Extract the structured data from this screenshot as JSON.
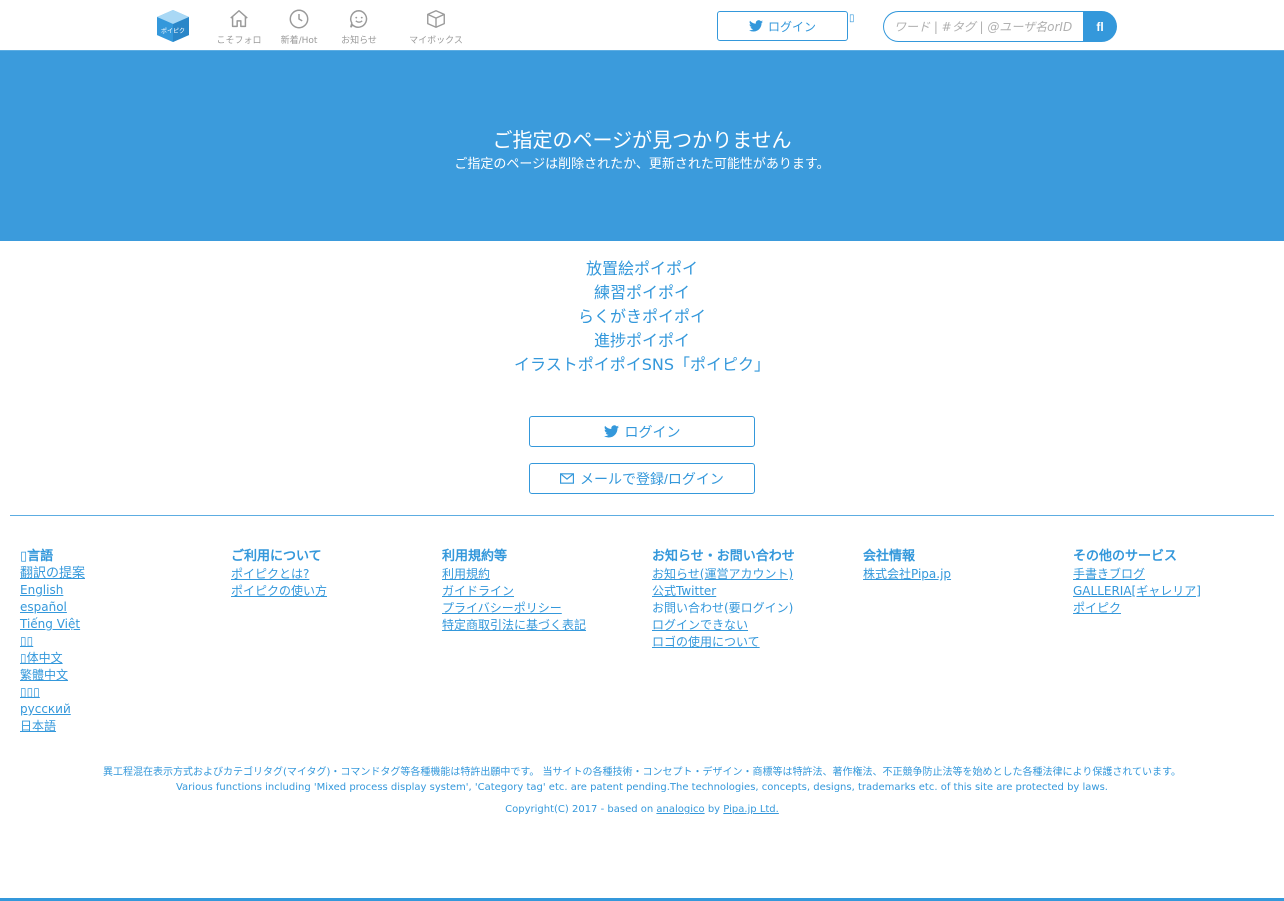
{
  "header": {
    "logo_text": "ポイピク",
    "nav": [
      {
        "label": "こそフォロ",
        "icon": "home-icon"
      },
      {
        "label": "新着/Hot",
        "icon": "clock-icon"
      },
      {
        "label": "お知らせ",
        "icon": "chat-icon"
      },
      {
        "label": "マイボックス",
        "icon": "box-icon"
      }
    ],
    "login_label": "ログイン",
    "tiny_glyph": "▯",
    "search_placeholder": "ワード | #タグ | @ユーザ名orID",
    "search_button": "fl"
  },
  "hero": {
    "title": "ご指定のページが見つかりません",
    "subtitle": "ご指定のページは削除されたか、更新された可能性があります。"
  },
  "links": [
    "放置絵ポイポイ",
    "練習ポイポイ",
    "らくがきポイポイ",
    "進捗ポイポイ",
    "イラストポイポイSNS「ポイピク」"
  ],
  "actions": {
    "twitter_login": "ログイン",
    "mail_login": "メールで登録/ログイン"
  },
  "footer": {
    "language": {
      "heading_glyph": "▯",
      "heading": "言語",
      "suggest": "翻訳の提案",
      "items": [
        "English",
        "español",
        "Tiếng Việt",
        "▯▯",
        "▯体中文",
        "繁體中文",
        "▯▯▯",
        "русский",
        "日本語"
      ]
    },
    "about": {
      "heading": "ご利用について",
      "items": [
        "ポイピクとは?",
        "ポイピクの使い方"
      ]
    },
    "terms": {
      "heading": "利用規約等",
      "items": [
        "利用規約",
        "ガイドライン",
        "プライバシーポリシー",
        "特定商取引法に基づく表記"
      ]
    },
    "contact": {
      "heading": "お知らせ・お問い合わせ",
      "items": [
        "お知らせ(運営アカウント)",
        "公式Twitter"
      ],
      "plain_item": "お問い合わせ(要ログイン)",
      "items2": [
        "ログインできない",
        "ロゴの使用について"
      ]
    },
    "company": {
      "heading": "会社情報",
      "items": [
        "株式会社Pipa.jp"
      ]
    },
    "services": {
      "heading": "その他のサービス",
      "items": [
        "手書きブログ",
        "GALLERIA[ギャレリア]",
        "ポイピク"
      ]
    },
    "notice_jp": "異工程混在表示方式およびカテゴリタグ(マイタグ)・コマンドタグ等各種機能は特許出願中です。 当サイトの各種技術・コンセプト・デザイン・商標等は特許法、著作権法、不正競争防止法等を始めとした各種法律により保護されています。",
    "notice_en": "Various functions including 'Mixed process display system', 'Category tag' etc. are patent pending.The technologies, concepts, designs, trademarks etc. of this site are protected by laws.",
    "copyright_prefix": "Copyright(C) 2017 - based on",
    "copyright_link1": "analogico",
    "copyright_by": "by",
    "copyright_link2": "Pipa.jp Ltd."
  },
  "colors": {
    "accent": "#3498db",
    "hero": "#3b9bdc",
    "muted": "#9a9a9a"
  }
}
